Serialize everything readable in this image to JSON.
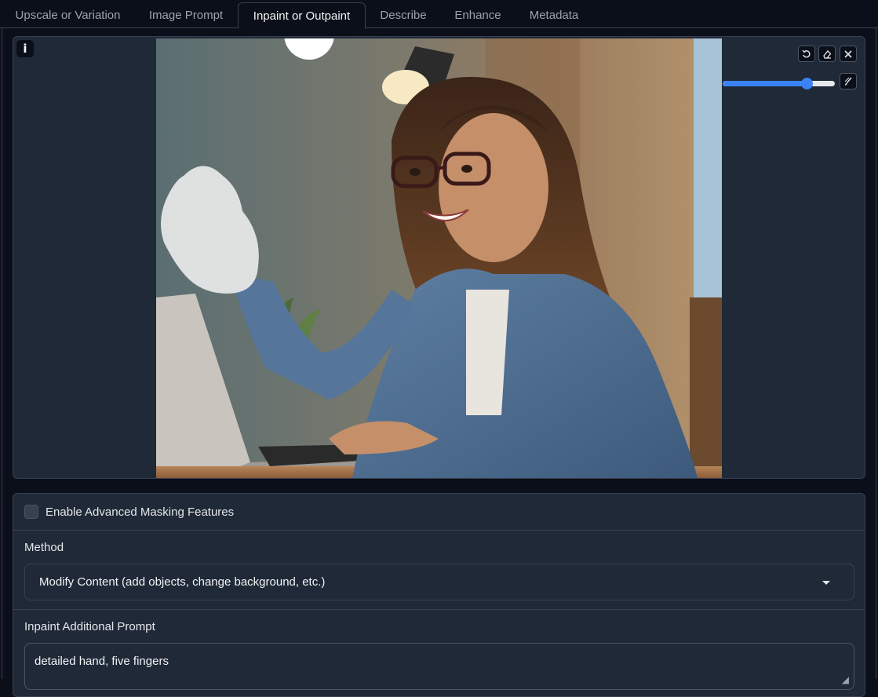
{
  "tabs": [
    {
      "label": "Upscale or Variation",
      "active": false
    },
    {
      "label": "Image Prompt",
      "active": false
    },
    {
      "label": "Inpaint or Outpaint",
      "active": true
    },
    {
      "label": "Describe",
      "active": false
    },
    {
      "label": "Enhance",
      "active": false
    },
    {
      "label": "Metadata",
      "active": false
    }
  ],
  "editor": {
    "info_glyph": "i",
    "toolbar": {
      "undo_icon": "undo-icon",
      "eraser_icon": "eraser-icon",
      "close_icon": "close-icon",
      "brush_icon": "brush-icon"
    },
    "brush_size_level": 0.75,
    "accent_color": "#3b82f6"
  },
  "settings": {
    "advanced_masking_label": "Enable Advanced Masking Features",
    "advanced_masking_checked": false,
    "method_label": "Method",
    "method_value": "Modify Content (add objects, change background, etc.)",
    "prompt_label": "Inpaint Additional Prompt",
    "prompt_value": "detailed hand, five fingers"
  }
}
